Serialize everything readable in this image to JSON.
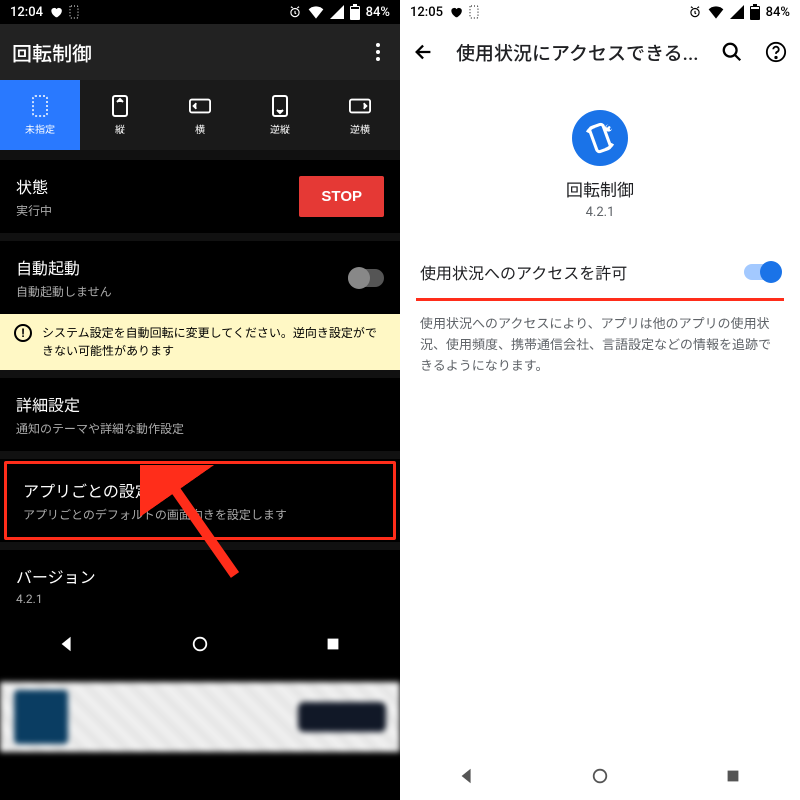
{
  "left": {
    "status": {
      "time": "12:04",
      "battery": "84%"
    },
    "appbar": {
      "title": "回転制御"
    },
    "tabs": [
      {
        "id": "unspecified",
        "label": "未指定",
        "active": true
      },
      {
        "id": "portrait",
        "label": "縦"
      },
      {
        "id": "landscape",
        "label": "横"
      },
      {
        "id": "rev-portrait",
        "label": "逆縦"
      },
      {
        "id": "rev-landscape",
        "label": "逆横"
      }
    ],
    "state": {
      "title": "状態",
      "subtitle": "実行中",
      "button": "STOP"
    },
    "autostart": {
      "title": "自動起動",
      "subtitle": "自動起動しません",
      "enabled": false
    },
    "warning": "システム設定を自動回転に変更してください。逆向き設定ができない可能性があります",
    "detail": {
      "title": "詳細設定",
      "subtitle": "通知のテーマや詳細な動作設定"
    },
    "perapp": {
      "title": "アプリごとの設定",
      "subtitle": "アプリごとのデフォルトの画面向きを設定します"
    },
    "version": {
      "title": "バージョン",
      "subtitle": "4.2.1"
    }
  },
  "right": {
    "status": {
      "time": "12:05",
      "battery": "84%"
    },
    "appbar": {
      "title": "使用状況にアクセスできる..."
    },
    "hero": {
      "name": "回転制御",
      "version": "4.2.1"
    },
    "permission": {
      "label": "使用状況へのアクセスを許可",
      "enabled": true
    },
    "description": "使用状況へのアクセスにより、アプリは他のアプリの使用状況、使用頻度、携帯通信会社、言語設定などの情報を追跡できるようになります。"
  },
  "icons": {
    "heart": "heart-icon",
    "alarm": "alarm-icon",
    "wifi": "wifi-icon",
    "signal": "signal-icon",
    "battery": "battery-icon",
    "dotted": "dotted-rect-icon",
    "search": "search-icon",
    "help": "help-icon",
    "back": "back-arrow-icon",
    "overflow": "overflow-menu-icon",
    "nav_back": "nav-back-icon",
    "nav_home": "nav-home-icon",
    "nav_recent": "nav-recent-icon",
    "rotate": "rotate-icon",
    "info": "info-icon"
  }
}
